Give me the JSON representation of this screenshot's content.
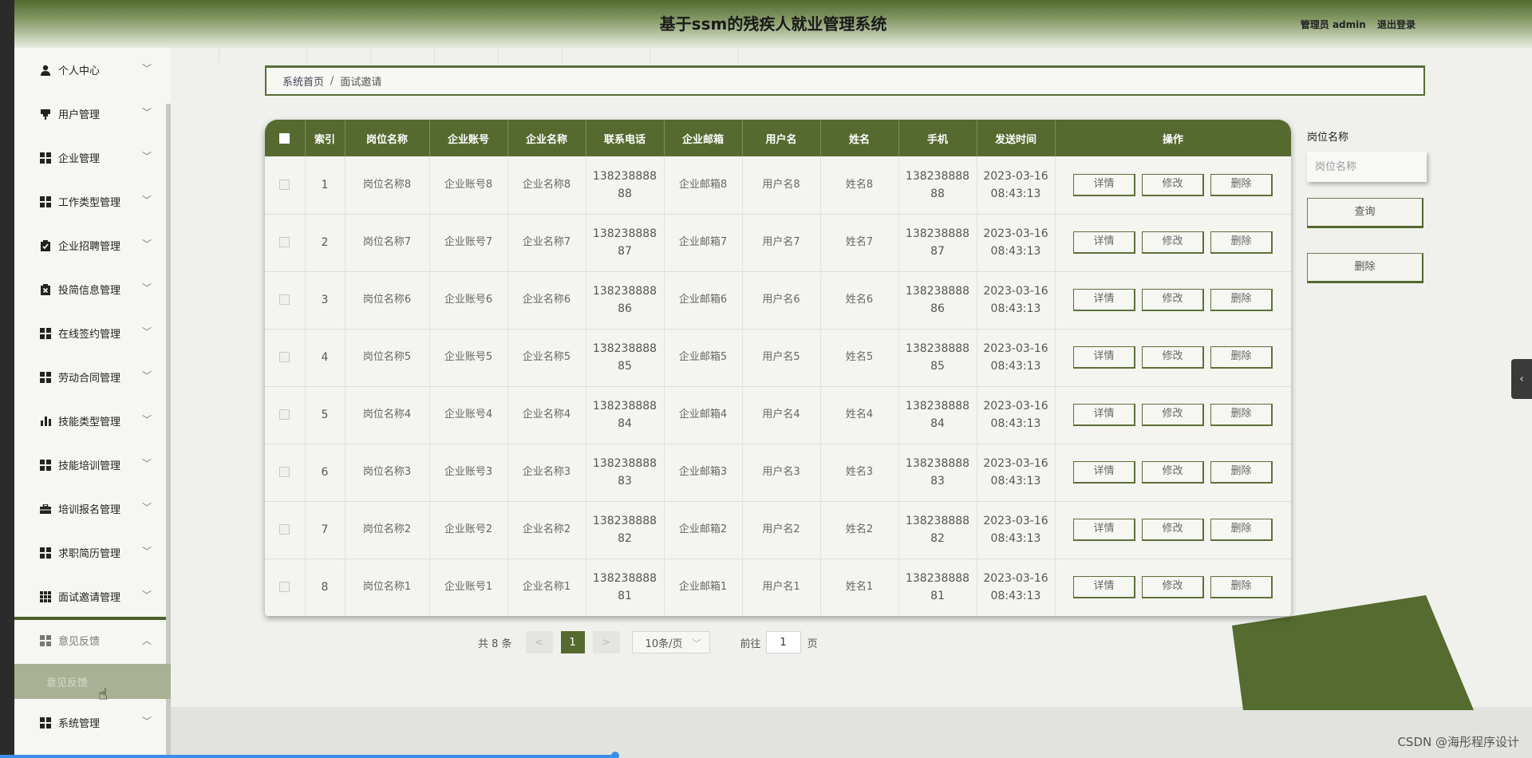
{
  "header": {
    "title": "基于ssm的残疾人就业管理系统",
    "user_label": "管理员 admin",
    "logout_label": "退出登录"
  },
  "sidebar": {
    "items": [
      {
        "label": "个人中心",
        "icon": "user-icon"
      },
      {
        "label": "用户管理",
        "icon": "pin-icon"
      },
      {
        "label": "企业管理",
        "icon": "grid-icon"
      },
      {
        "label": "工作类型管理",
        "icon": "grid-icon"
      },
      {
        "label": "企业招聘管理",
        "icon": "clipboard-check-icon"
      },
      {
        "label": "投简信息管理",
        "icon": "clipboard-x-icon"
      },
      {
        "label": "在线签约管理",
        "icon": "grid-icon"
      },
      {
        "label": "劳动合同管理",
        "icon": "grid-icon"
      },
      {
        "label": "技能类型管理",
        "icon": "bar-chart-icon"
      },
      {
        "label": "技能培训管理",
        "icon": "grid-icon"
      },
      {
        "label": "培训报名管理",
        "icon": "briefcase-icon"
      },
      {
        "label": "求职简历管理",
        "icon": "grid-icon"
      },
      {
        "label": "面试邀请管理",
        "icon": "grid9-icon"
      },
      {
        "label": "意见反馈",
        "icon": "grid-icon",
        "expanded": true
      },
      {
        "label": "系统管理",
        "icon": "grid-icon"
      }
    ],
    "sub_item": {
      "label": "意见反馈"
    }
  },
  "breadcrumb": {
    "home": "系统首页",
    "separator": "/",
    "current": "面试邀请"
  },
  "table": {
    "headers": [
      "索引",
      "岗位名称",
      "企业账号",
      "企业名称",
      "联系电话",
      "企业邮箱",
      "用户名",
      "姓名",
      "手机",
      "发送时间",
      "操作"
    ],
    "rows": [
      {
        "index": "1",
        "job": "岗位名称8",
        "account": "企业账号8",
        "company": "企业名称8",
        "phone_a": "138238888",
        "phone_b": "88",
        "email": "企业邮箱8",
        "username": "用户名8",
        "name": "姓名8",
        "mobile_a": "138238888",
        "mobile_b": "88",
        "date": "2023-03-16",
        "time": "08:43:13"
      },
      {
        "index": "2",
        "job": "岗位名称7",
        "account": "企业账号7",
        "company": "企业名称7",
        "phone_a": "138238888",
        "phone_b": "87",
        "email": "企业邮箱7",
        "username": "用户名7",
        "name": "姓名7",
        "mobile_a": "138238888",
        "mobile_b": "87",
        "date": "2023-03-16",
        "time": "08:43:13"
      },
      {
        "index": "3",
        "job": "岗位名称6",
        "account": "企业账号6",
        "company": "企业名称6",
        "phone_a": "138238888",
        "phone_b": "86",
        "email": "企业邮箱6",
        "username": "用户名6",
        "name": "姓名6",
        "mobile_a": "138238888",
        "mobile_b": "86",
        "date": "2023-03-16",
        "time": "08:43:13"
      },
      {
        "index": "4",
        "job": "岗位名称5",
        "account": "企业账号5",
        "company": "企业名称5",
        "phone_a": "138238888",
        "phone_b": "85",
        "email": "企业邮箱5",
        "username": "用户名5",
        "name": "姓名5",
        "mobile_a": "138238888",
        "mobile_b": "85",
        "date": "2023-03-16",
        "time": "08:43:13"
      },
      {
        "index": "5",
        "job": "岗位名称4",
        "account": "企业账号4",
        "company": "企业名称4",
        "phone_a": "138238888",
        "phone_b": "84",
        "email": "企业邮箱4",
        "username": "用户名4",
        "name": "姓名4",
        "mobile_a": "138238888",
        "mobile_b": "84",
        "date": "2023-03-16",
        "time": "08:43:13"
      },
      {
        "index": "6",
        "job": "岗位名称3",
        "account": "企业账号3",
        "company": "企业名称3",
        "phone_a": "138238888",
        "phone_b": "83",
        "email": "企业邮箱3",
        "username": "用户名3",
        "name": "姓名3",
        "mobile_a": "138238888",
        "mobile_b": "83",
        "date": "2023-03-16",
        "time": "08:43:13"
      },
      {
        "index": "7",
        "job": "岗位名称2",
        "account": "企业账号2",
        "company": "企业名称2",
        "phone_a": "138238888",
        "phone_b": "82",
        "email": "企业邮箱2",
        "username": "用户名2",
        "name": "姓名2",
        "mobile_a": "138238888",
        "mobile_b": "82",
        "date": "2023-03-16",
        "time": "08:43:13"
      },
      {
        "index": "8",
        "job": "岗位名称1",
        "account": "企业账号1",
        "company": "企业名称1",
        "phone_a": "138238888",
        "phone_b": "81",
        "email": "企业邮箱1",
        "username": "用户名1",
        "name": "姓名1",
        "mobile_a": "138238888",
        "mobile_b": "81",
        "date": "2023-03-16",
        "time": "08:43:13"
      }
    ],
    "actions": {
      "detail": "详情",
      "edit": "修改",
      "delete": "删除"
    }
  },
  "search": {
    "label": "岗位名称",
    "placeholder": "岗位名称",
    "query_button": "查询",
    "delete_button": "删除"
  },
  "pagination": {
    "total": "共 8 条",
    "prev": "<",
    "current_page": "1",
    "next": ">",
    "page_size": "10条/页",
    "goto_label": "前往",
    "goto_value": "1",
    "goto_suffix": "页"
  },
  "watermark": "CSDN @海彤程序设计",
  "colors": {
    "accent": "#566a2f",
    "header_dark": "#4f6a2c",
    "background": "#f0f1ed"
  }
}
